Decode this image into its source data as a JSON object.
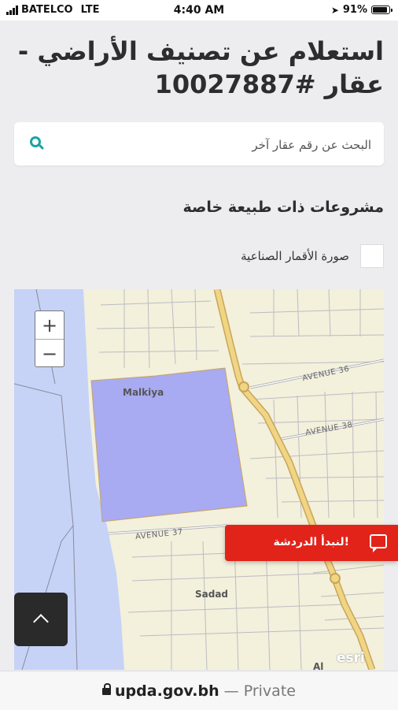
{
  "status_bar": {
    "carrier": "BATELCO",
    "network": "LTE",
    "time": "4:40 AM",
    "battery": "91%",
    "battery_level": 0.91
  },
  "page": {
    "title": "استعلام عن تصنيف الأراضي - عقار #10027887"
  },
  "search": {
    "placeholder": "البحث عن رقم عقار آخر",
    "icon": "search-icon",
    "accent": "#1aa3a8"
  },
  "special_projects": {
    "heading": "مشروعات ذات طبيعة خاصة",
    "satellite_label": "صورة الأقمار الصناعية",
    "satellite_checked": false
  },
  "map": {
    "zoom_in": "+",
    "zoom_out": "−",
    "labels": {
      "malkiya": "Malkiya",
      "sadad": "Sadad",
      "al_shahraqan": "Al Shahraqan"
    },
    "avenues": [
      "AVENUE 36",
      "AVENUE 38",
      "AVENUE 37"
    ],
    "attribution": "esri",
    "parcel_color": "#a8aaf2",
    "water_color": "#c6d3f7"
  },
  "chat": {
    "label": "!لنبدأ الدردشة",
    "color": "#e2231a",
    "icon": "chat-bubble-icon"
  },
  "scroll_top": {
    "icon": "chevron-up-icon"
  },
  "browser": {
    "host": "upda.gov.bh",
    "separator": "—",
    "mode": "Private"
  }
}
